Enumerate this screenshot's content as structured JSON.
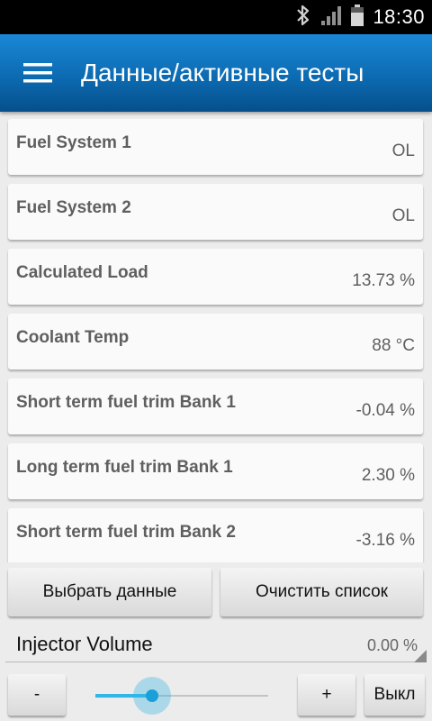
{
  "status_bar": {
    "time": "18:30",
    "icons": [
      "bluetooth-icon",
      "signal-icon",
      "battery-icon"
    ]
  },
  "action_bar": {
    "menu_icon": "hamburger-menu-icon",
    "title": "Данные/активные тесты",
    "colors": {
      "top": "#1a88d6",
      "bottom": "#064f8a"
    }
  },
  "pids": [
    {
      "label": "Fuel System 1",
      "value": "OL"
    },
    {
      "label": "Fuel System 2",
      "value": "OL"
    },
    {
      "label": "Calculated Load",
      "value": "13.73 %"
    },
    {
      "label": "Coolant Temp",
      "value": "88 °C"
    },
    {
      "label": "Short term fuel trim Bank 1",
      "value": "-0.04 %"
    },
    {
      "label": "Long term fuel trim Bank 1",
      "value": "2.30 %"
    },
    {
      "label": "Short term fuel trim Bank 2",
      "value": "-3.16 %"
    }
  ],
  "buttons": {
    "select": "Выбрать данные",
    "clear": "Очистить список",
    "minus": "-",
    "plus": "+",
    "off": "Выкл"
  },
  "active_test": {
    "label": "Injector Volume",
    "value": "0.00 %",
    "slider_fraction": 0.33,
    "accent": "#33b5e5"
  }
}
